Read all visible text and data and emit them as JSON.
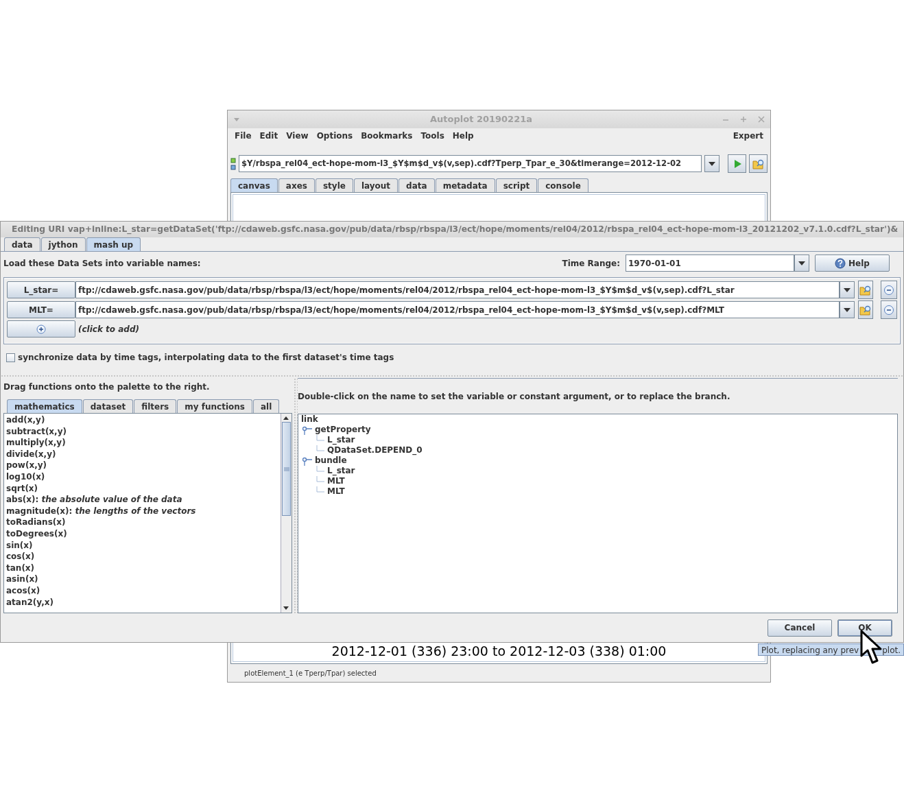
{
  "main_window": {
    "title": "Autoplot 20190221a",
    "menu": [
      "File",
      "Edit",
      "View",
      "Options",
      "Bookmarks",
      "Tools",
      "Help"
    ],
    "menu_right": "Expert",
    "uri": "$Y/rbspa_rel04_ect-hope-mom-l3_$Y$m$d_v$(v,sep).cdf?Tperp_Tpar_e_30&timerange=2012-12-02",
    "tabs": [
      {
        "label": "canvas",
        "selected": true
      },
      {
        "label": "axes",
        "selected": false
      },
      {
        "label": "style",
        "selected": false
      },
      {
        "label": "layout",
        "selected": false
      },
      {
        "label": "data",
        "selected": false
      },
      {
        "label": "metadata",
        "selected": false
      },
      {
        "label": "script",
        "selected": false
      },
      {
        "label": "console",
        "selected": false
      }
    ],
    "canvas_time": "2012-12-01 (336) 23:00 to 2012-12-03 (338) 01:00",
    "status_bar": "plotElement_1 (e Tperp/Tpar) selected"
  },
  "dialog": {
    "title": "Editing URI vap+inline:L_star=getDataSet('ftp://cdaweb.gsfc.nasa.gov/pub/data/rbsp/rbspa/l3/ect/hope/moments/rel04/2012/rbspa_rel04_ect-hope-mom-l3_20121202_v7.1.0.cdf?L_star')&",
    "tabs": [
      {
        "label": "data",
        "selected": false
      },
      {
        "label": "jython",
        "selected": false
      },
      {
        "label": "mash up",
        "selected": true
      }
    ],
    "load_label": "Load these Data Sets into variable names:",
    "time_range_label": "Time Range:",
    "time_range": "1970-01-01",
    "help_button": "Help",
    "datasets": [
      {
        "name": "L_star=",
        "uri": "ftp://cdaweb.gsfc.nasa.gov/pub/data/rbsp/rbspa/l3/ect/hope/moments/rel04/2012/rbspa_rel04_ect-hope-mom-l3_$Y$m$d_v$(v,sep).cdf?L_star"
      },
      {
        "name": "MLT=",
        "uri": "ftp://cdaweb.gsfc.nasa.gov/pub/data/rbsp/rbspa/l3/ect/hope/moments/rel04/2012/rbspa_rel04_ect-hope-mom-l3_$Y$m$d_v$(v,sep).cdf?MLT"
      }
    ],
    "add_hint": "(click to add)",
    "synchronize": {
      "label": "synchronize data by time tags, interpolating data to the first dataset's time tags",
      "checked": false
    },
    "palette_hint": "Drag functions onto the palette to the right.",
    "palette_tabs": [
      {
        "label": "mathematics",
        "selected": true
      },
      {
        "label": "dataset",
        "selected": false
      },
      {
        "label": "filters",
        "selected": false
      },
      {
        "label": "my functions",
        "selected": false
      },
      {
        "label": "all",
        "selected": false
      }
    ],
    "functions": [
      "add(x,y)",
      "subtract(x,y)",
      "multiply(x,y)",
      "divide(x,y)",
      "pow(x,y)",
      "log10(x)",
      "sqrt(x)",
      "abs(x): *the absolute value of the data*",
      "magnitude(x): *the lengths of the vectors*",
      "toRadians(x)",
      "toDegrees(x)",
      "sin(x)",
      "cos(x)",
      "tan(x)",
      "asin(x)",
      "acos(x)",
      "atan2(y,x)"
    ],
    "tree_hint": "Double-click on the name to set the variable or constant argument, or to replace the branch.",
    "tree": {
      "label": "link",
      "children": [
        {
          "label": "getProperty",
          "children": [
            {
              "label": "L_star"
            },
            {
              "label": "QDataSet.DEPEND_0"
            }
          ]
        },
        {
          "label": "bundle",
          "children": [
            {
              "label": "L_star"
            },
            {
              "label": "MLT"
            },
            {
              "label": "MLT"
            }
          ]
        }
      ]
    },
    "buttons": [
      "Cancel",
      "OK"
    ]
  },
  "tooltip": [
    "Plot, replacing any prev",
    "plot."
  ]
}
